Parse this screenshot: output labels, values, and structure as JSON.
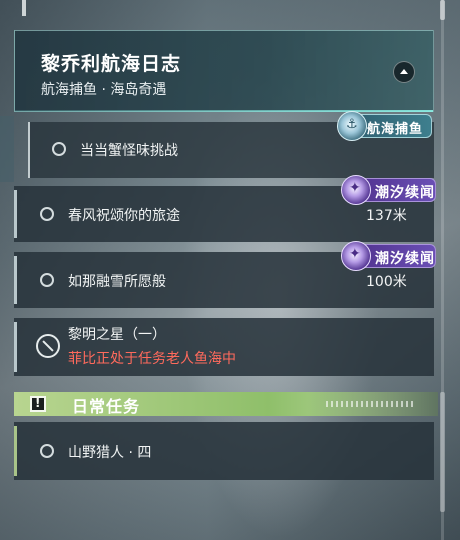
{
  "header": {
    "title": "黎乔利航海日志",
    "subtitle": "航海捕鱼 · 海岛奇遇"
  },
  "quests": [
    {
      "label": "当当蟹怪味挑战",
      "tag": "航海捕鱼",
      "tag_icon": "anchor-icon",
      "distance": ""
    },
    {
      "label": "春风祝颂你的旅途",
      "tag": "潮汐续闻",
      "tag_icon": "sparkle-icon",
      "distance": "137米"
    },
    {
      "label": "如那融雪所愿般",
      "tag": "潮汐续闻",
      "tag_icon": "sparkle-icon",
      "distance": "100米"
    }
  ],
  "event": {
    "title": "黎明之星（一）",
    "warning": "菲比正处于任务老人鱼海中",
    "warning_color": "#ff6a5c"
  },
  "daily": {
    "title": "日常任务",
    "accent": "#a9c489",
    "items": [
      {
        "label": "山野猎人 · 四"
      }
    ]
  },
  "colors": {
    "tag_tidal": "#6a4fb5",
    "tag_fishing": "#3e7f8e",
    "header_border": "#8ee0d8"
  }
}
